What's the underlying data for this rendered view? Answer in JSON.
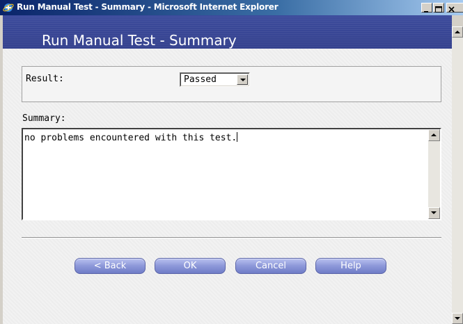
{
  "window": {
    "title": "Run Manual Test - Summary - Microsoft Internet Explorer",
    "icon": "ie-icon",
    "controls": [
      "minimize-icon",
      "maximize-icon",
      "close-icon"
    ]
  },
  "header": {
    "title": "Run Manual Test - Summary"
  },
  "form": {
    "result_label": "Result:",
    "result_value": "Passed",
    "summary_label": "Summary:",
    "summary_text": "no problems encountered with this test."
  },
  "buttons": {
    "back": "< Back",
    "ok": "OK",
    "cancel": "Cancel",
    "help": "Help"
  },
  "colors": {
    "titlebar": "#0a246a",
    "header": "#3c4b9c",
    "button": "#8d98d9"
  }
}
